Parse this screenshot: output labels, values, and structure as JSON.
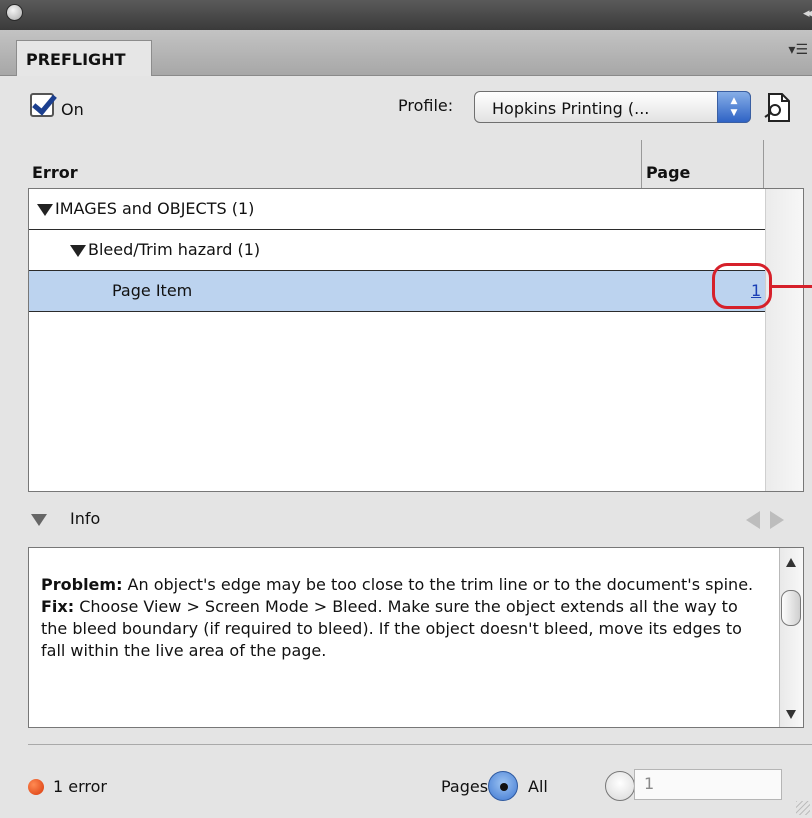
{
  "panel": {
    "tab_label": "PREFLIGHT",
    "on_checkbox": {
      "label": "On",
      "checked": true
    },
    "profile": {
      "label": "Profile:",
      "value": "Hopkins Printing (..."
    }
  },
  "error_list": {
    "columns": [
      "Error",
      "Page"
    ],
    "rows": [
      {
        "label": "IMAGES and OBJECTS (1)",
        "level": 0,
        "expanded": true
      },
      {
        "label": "Bleed/Trim hazard (1)",
        "level": 1,
        "expanded": true
      },
      {
        "label": "Page Item",
        "level": 2,
        "page": "1",
        "selected": true
      }
    ]
  },
  "info": {
    "label": "Info",
    "problem_label": "Problem:",
    "problem_text": " An object's edge may be too close to the trim line or to the document's spine.",
    "fix_label": "Fix:",
    "fix_text": " Choose View > Screen Mode > Bleed. Make sure the object extends all the way to the bleed boundary (if required to bleed). If the object doesn't bleed, move its edges to fall within the live area of the page."
  },
  "footer": {
    "error_count": "1 error",
    "pages_label": "Pages:",
    "all_label": "All",
    "range_value": "1"
  },
  "colors": {
    "selected_row": "#bcd3ef",
    "callout": "#d6202a",
    "error_dot": "#d93a0d",
    "link": "#1a3fb5"
  }
}
